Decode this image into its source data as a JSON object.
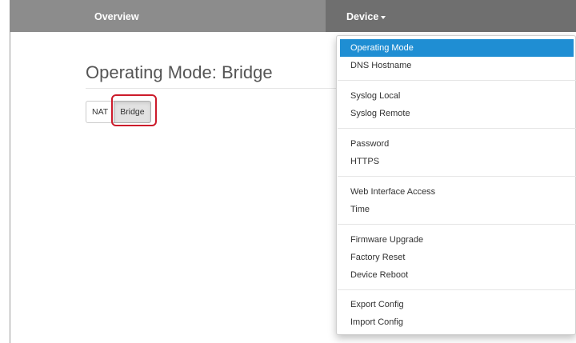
{
  "nav": {
    "overview_label": "Overview",
    "device_label": "Device"
  },
  "page": {
    "title": "Operating Mode: Bridge"
  },
  "mode_buttons": {
    "nat_label": "NAT",
    "bridge_label": "Bridge",
    "selected": "Bridge"
  },
  "device_menu": {
    "items": [
      "Operating Mode",
      "DNS Hostname",
      "Syslog Local",
      "Syslog Remote",
      "Password",
      "HTTPS",
      "Web Interface Access",
      "Time",
      "Firmware Upgrade",
      "Factory Reset",
      "Device Reboot",
      "Export Config",
      "Import Config"
    ],
    "active_item": "Operating Mode"
  },
  "colors": {
    "navbar": "#8c8c8c",
    "navbar_active": "#6f6f6f",
    "menu_active": "#1f8ed3",
    "highlight": "#cc1b2b"
  }
}
